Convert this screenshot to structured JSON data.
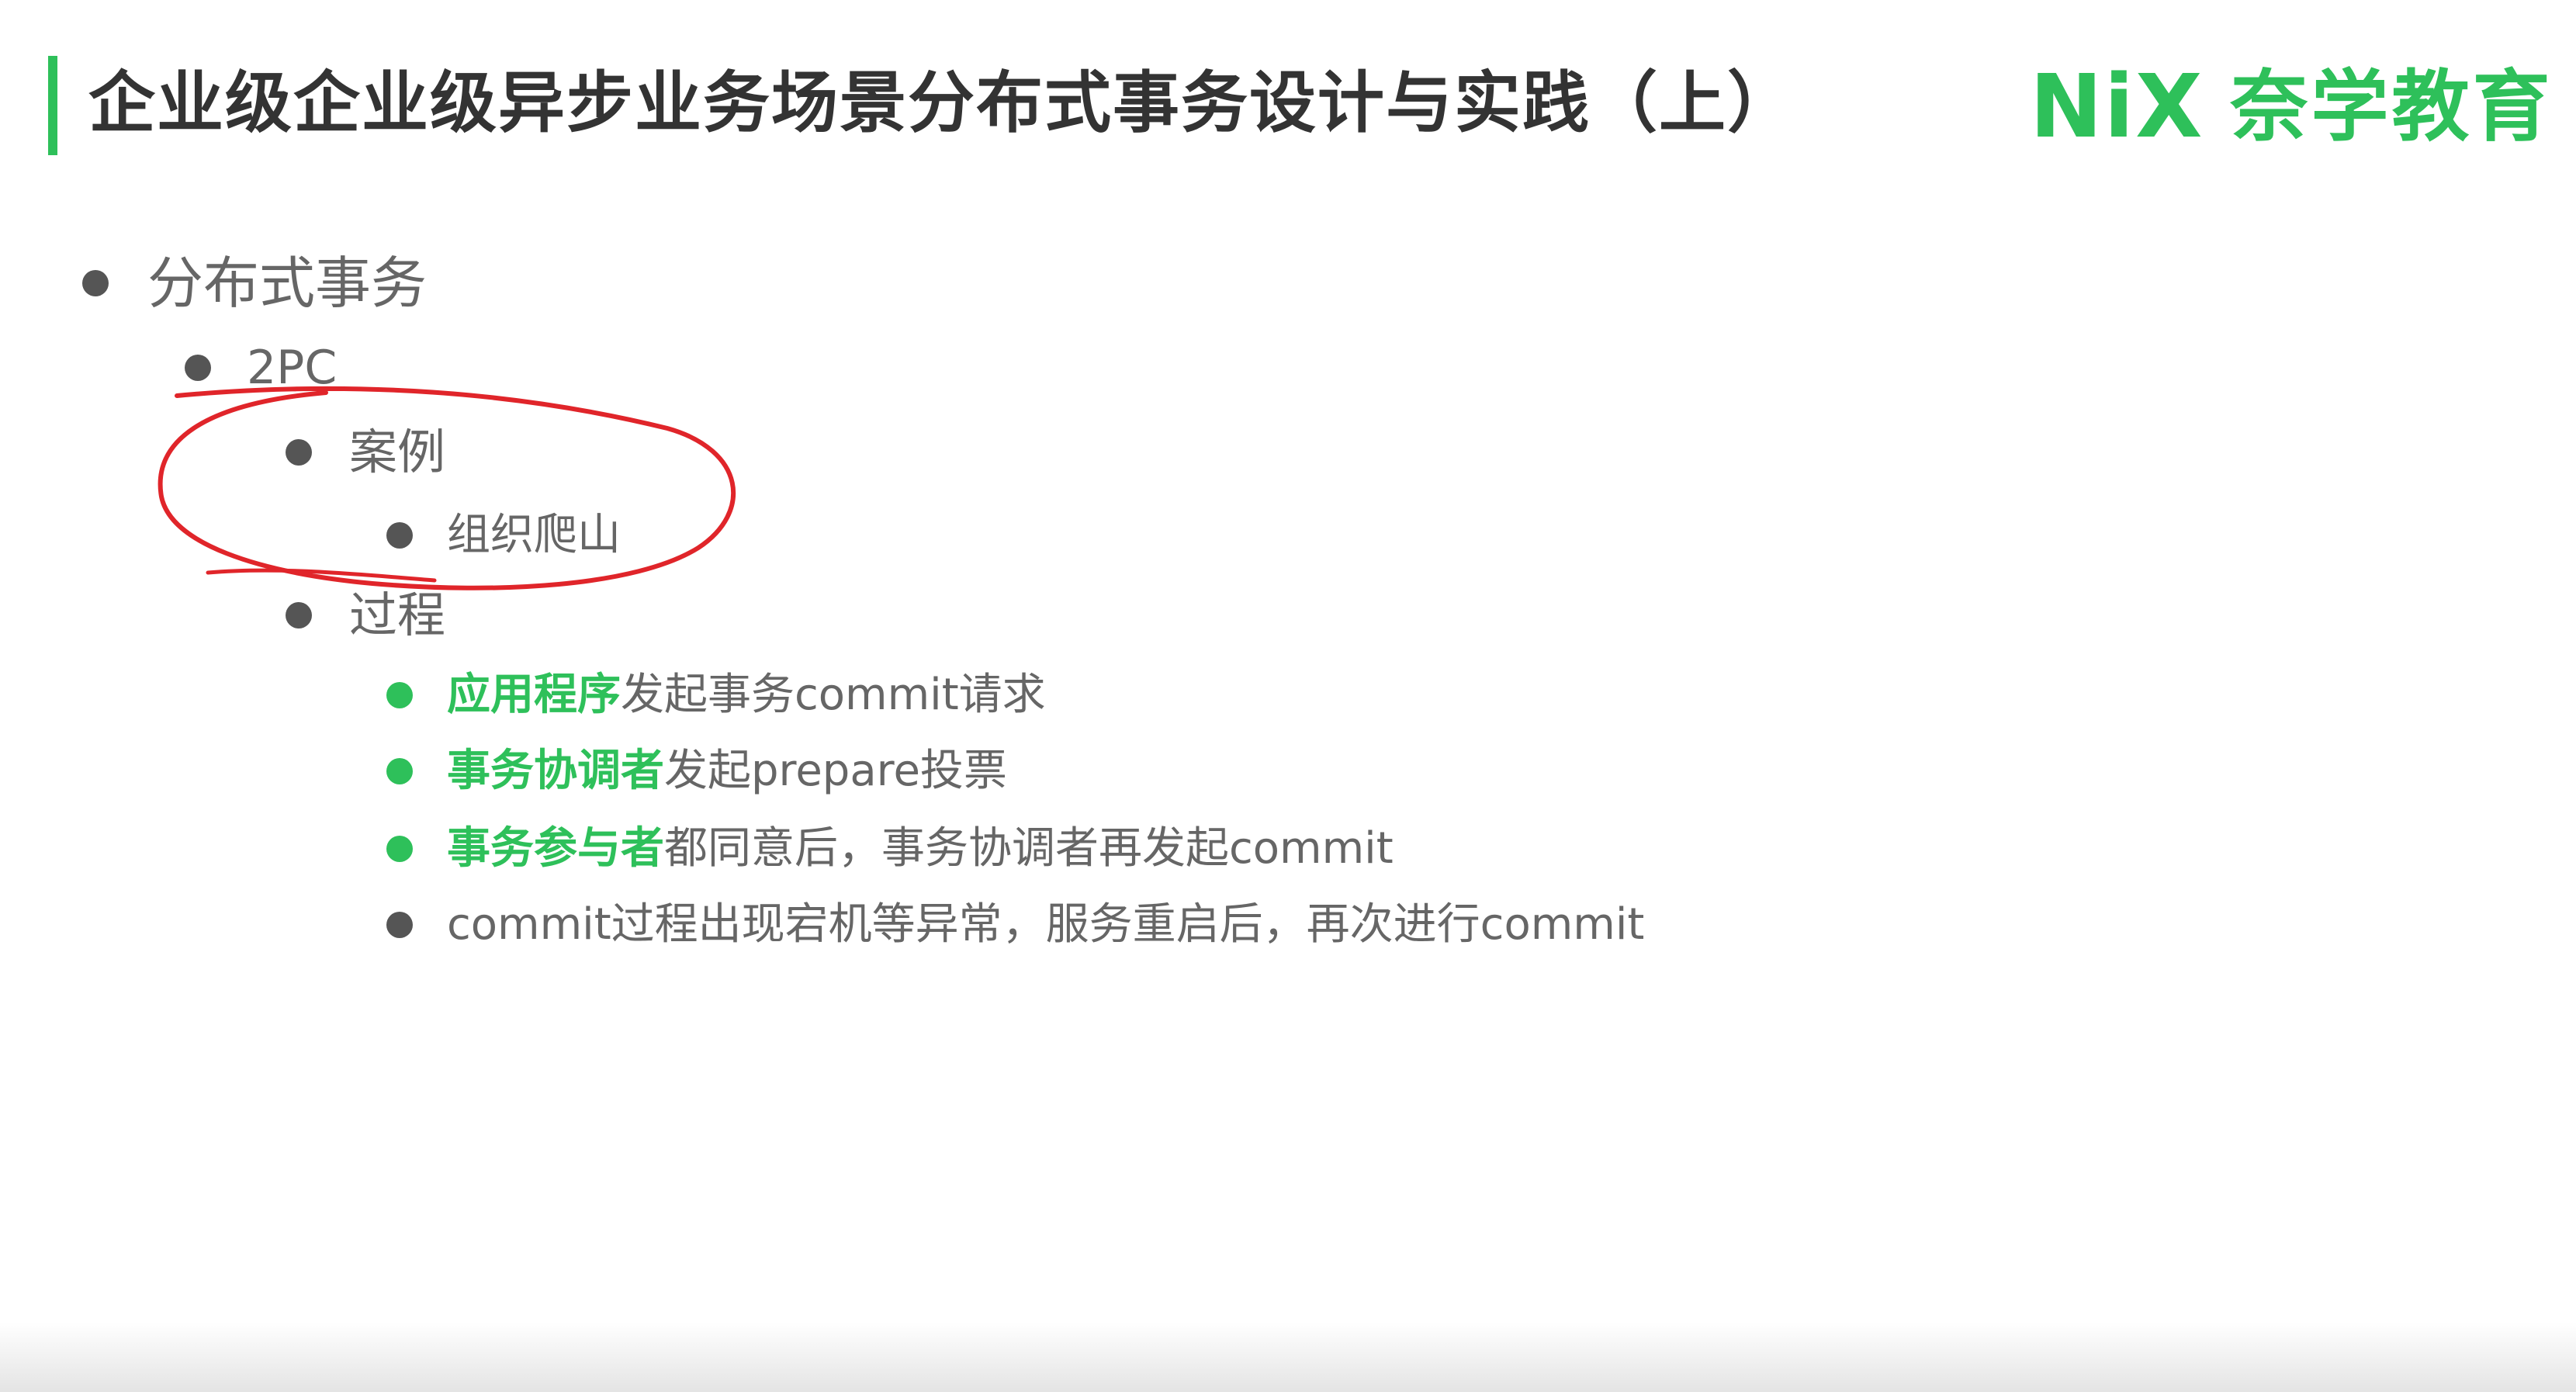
{
  "header": {
    "title": "企业级企业级异步业务场景分布式事务设计与实践（上）",
    "logo_mark": "NiX",
    "logo_text": "奈学教育",
    "accent_color": "#2ec05a"
  },
  "outline": {
    "level1": "分布式事务",
    "level2": "2PC",
    "case_label": "案例",
    "case_item": "组织爬山",
    "process_label": "过程",
    "steps": [
      {
        "highlight": "应用程序",
        "rest": "发起事务commit请求"
      },
      {
        "highlight": "事务协调者",
        "rest": "发起prepare投票"
      },
      {
        "highlight": "事务参与者",
        "rest": "都同意后，事务协调者再发起commit"
      },
      {
        "highlight": "",
        "rest": "commit过程出现宕机等异常，服务重启后，再次进行commit"
      }
    ]
  },
  "annotation": {
    "color": "#e0252a",
    "shape": "hand-drawn-circle"
  }
}
